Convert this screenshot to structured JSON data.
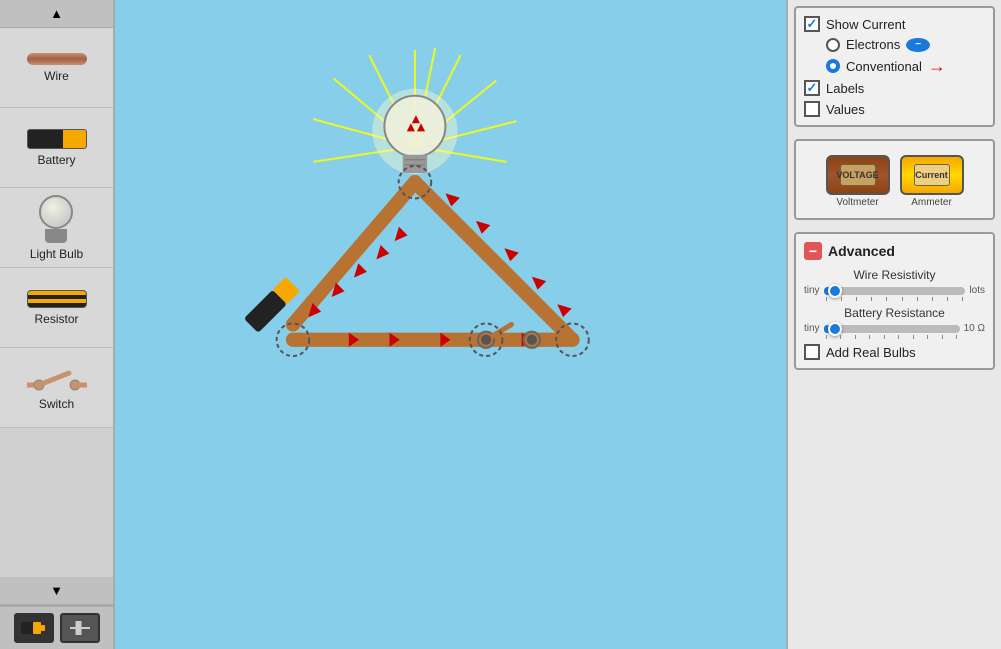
{
  "sidebar": {
    "scroll_up_label": "▲",
    "scroll_down_label": "▼",
    "items": [
      {
        "id": "wire",
        "label": "Wire"
      },
      {
        "id": "battery",
        "label": "Battery"
      },
      {
        "id": "light-bulb",
        "label": "Light Bulb"
      },
      {
        "id": "resistor",
        "label": "Resistor"
      },
      {
        "id": "switch",
        "label": "Switch"
      }
    ],
    "tools": [
      {
        "id": "battery-tool",
        "active": true
      },
      {
        "id": "capacitor-tool",
        "active": false
      }
    ]
  },
  "right_panel": {
    "show_current_label": "Show Current",
    "show_current_checked": true,
    "electrons_label": "Electrons",
    "conventional_label": "Conventional",
    "labels_label": "Labels",
    "labels_checked": true,
    "values_label": "Values",
    "values_checked": false,
    "voltmeter_label": "Voltmeter",
    "ammeter_label": "Ammeter",
    "advanced_label": "Advanced",
    "wire_resistivity_label": "Wire Resistivity",
    "wire_tiny_label": "tiny",
    "wire_lots_label": "lots",
    "wire_slider_pct": 5,
    "battery_resistance_label": "Battery Resistance",
    "battery_tiny_label": "tiny",
    "battery_10ohm_label": "10 Ω",
    "battery_slider_pct": 5,
    "add_real_bulbs_label": "Add Real Bulbs",
    "add_real_bulbs_checked": false
  }
}
